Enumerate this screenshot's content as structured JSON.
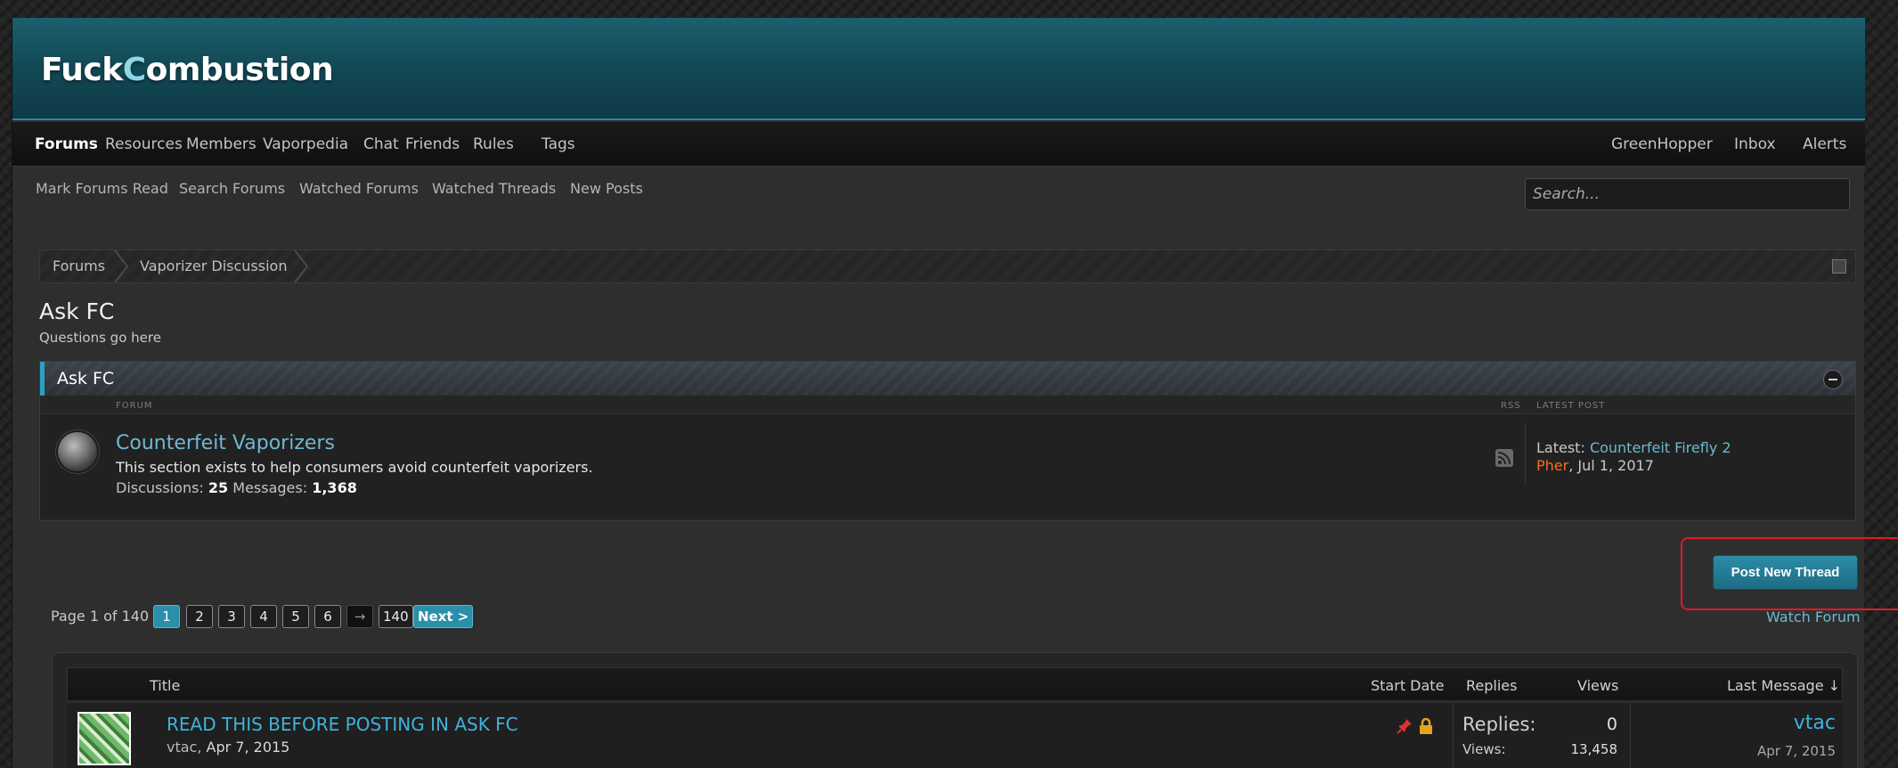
{
  "header": {
    "logo_part1": "Fuck",
    "logo_accent": "C",
    "logo_part2": "ombustion"
  },
  "nav": {
    "items": [
      "Forums",
      "Resources",
      "Members",
      "Vaporpedia",
      "Chat",
      "Friends",
      "Rules",
      "Tags"
    ],
    "right_items": [
      "GreenHopper",
      "Inbox",
      "Alerts"
    ]
  },
  "subnav": {
    "items": [
      "Mark Forums Read",
      "Search Forums",
      "Watched Forums",
      "Watched Threads",
      "New Posts"
    ],
    "search_placeholder": "Search..."
  },
  "breadcrumb": [
    "Forums",
    "Vaporizer Discussion"
  ],
  "page": {
    "title": "Ask FC",
    "description": "Questions go here"
  },
  "category": {
    "title": "Ask FC",
    "columns": {
      "forum": "FORUM",
      "rss": "RSS",
      "latest": "LATEST POST"
    },
    "forum": {
      "name": "Counterfeit Vaporizers",
      "description": "This section exists to help consumers avoid counterfeit vaporizers.",
      "discussions_label": "Discussions:",
      "discussions": "25",
      "messages_label": "Messages:",
      "messages": "1,368",
      "latest_label": "Latest:",
      "latest_thread": "Counterfeit Firefly 2",
      "latest_user": "Pher",
      "latest_date": "Jul 1, 2017"
    }
  },
  "actions": {
    "post_new_thread": "Post New Thread",
    "watch_forum": "Watch Forum"
  },
  "pagination": {
    "label": "Page 1 of 140",
    "pages": [
      "1",
      "2",
      "3",
      "4",
      "5",
      "6"
    ],
    "skip": "→",
    "last": "140",
    "next": "Next >"
  },
  "thread_list": {
    "headers": {
      "title": "Title",
      "start_date": "Start Date",
      "replies": "Replies",
      "views": "Views",
      "last_message": "Last Message ↓"
    },
    "rows": [
      {
        "title": "READ THIS BEFORE POSTING IN ASK FC",
        "author": "vtac",
        "date": "Apr 7, 2015",
        "replies_label": "Replies:",
        "replies": "0",
        "views_label": "Views:",
        "views": "13,458",
        "last_user": "vtac",
        "last_date": "Apr 7, 2015"
      }
    ]
  },
  "colors": {
    "accent": "#2a8fa9",
    "link": "#6fb8d0",
    "highlight": "#e01a28",
    "user_orange": "#ff6a1f"
  }
}
